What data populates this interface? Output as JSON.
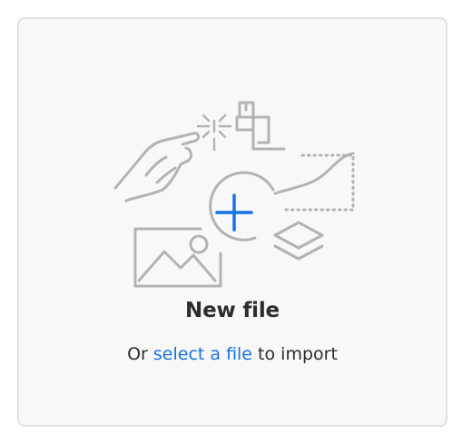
{
  "dropzone": {
    "title": "New file",
    "subtitle_before": "Or ",
    "subtitle_link": "select a file",
    "subtitle_after": " to import"
  },
  "colors": {
    "accent": "#1473e6",
    "illustration_stroke": "#b3b3b3",
    "text": "#2c2c2c",
    "card_bg": "#f8f8f8",
    "card_border": "#e1e1e1"
  },
  "icons": [
    "hand-pointer-icon",
    "sparkle-icon",
    "crop-icon",
    "curve-path-icon",
    "plus-circle-icon",
    "image-icon",
    "layers-icon"
  ]
}
